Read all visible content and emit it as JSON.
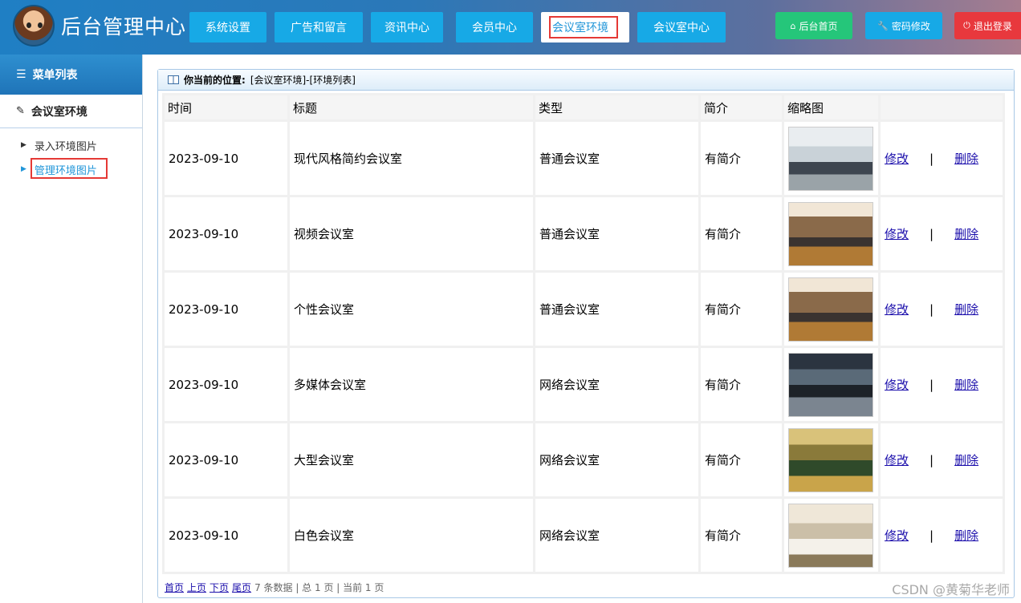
{
  "header": {
    "title": "后台管理中心",
    "nav": [
      "系统设置",
      "广告和留言",
      "资讯中心",
      "会员中心",
      "会议室环境",
      "会议室中心"
    ],
    "active_nav": "会议室环境",
    "home_label": "后台首页",
    "password_label": "密码修改",
    "logout_label": "退出登录",
    "colors": {
      "home": "#25c67a",
      "password": "#17a9e6",
      "logout": "#e8383d"
    }
  },
  "sidebar": {
    "menu_title": "菜单列表",
    "group_title": "会议室环境",
    "items": [
      "录入环境图片",
      "管理环境图片"
    ],
    "active_item": "管理环境图片"
  },
  "breadcrumb": {
    "label": "你当前的位置:",
    "path": "[会议室环境]-[环境列表]"
  },
  "table": {
    "columns": [
      "时间",
      "标题",
      "类型",
      "简介",
      "缩略图",
      ""
    ],
    "rows": [
      {
        "time": "2023-09-10",
        "title": "现代风格简约会议室",
        "type": "普通会议室",
        "intro": "有简介",
        "thumb": "light"
      },
      {
        "time": "2023-09-10",
        "title": "视频会议室",
        "type": "普通会议室",
        "intro": "有简介",
        "thumb": "warm"
      },
      {
        "time": "2023-09-10",
        "title": "个性会议室",
        "type": "普通会议室",
        "intro": "有简介",
        "thumb": "warm"
      },
      {
        "time": "2023-09-10",
        "title": "多媒体会议室",
        "type": "网络会议室",
        "intro": "有简介",
        "thumb": "dark"
      },
      {
        "time": "2023-09-10",
        "title": "大型会议室",
        "type": "网络会议室",
        "intro": "有简介",
        "thumb": "gold"
      },
      {
        "time": "2023-09-10",
        "title": "白色会议室",
        "type": "网络会议室",
        "intro": "有简介",
        "thumb": "white"
      }
    ],
    "edit_label": "修改",
    "separator": "|",
    "delete_label": "删除"
  },
  "pager": {
    "first": "首页",
    "prev": "上页",
    "next": "下页",
    "last": "尾页",
    "summary": "7 条数据 | 总 1 页 | 当前 1 页"
  },
  "watermark": "CSDN @黄菊华老师"
}
